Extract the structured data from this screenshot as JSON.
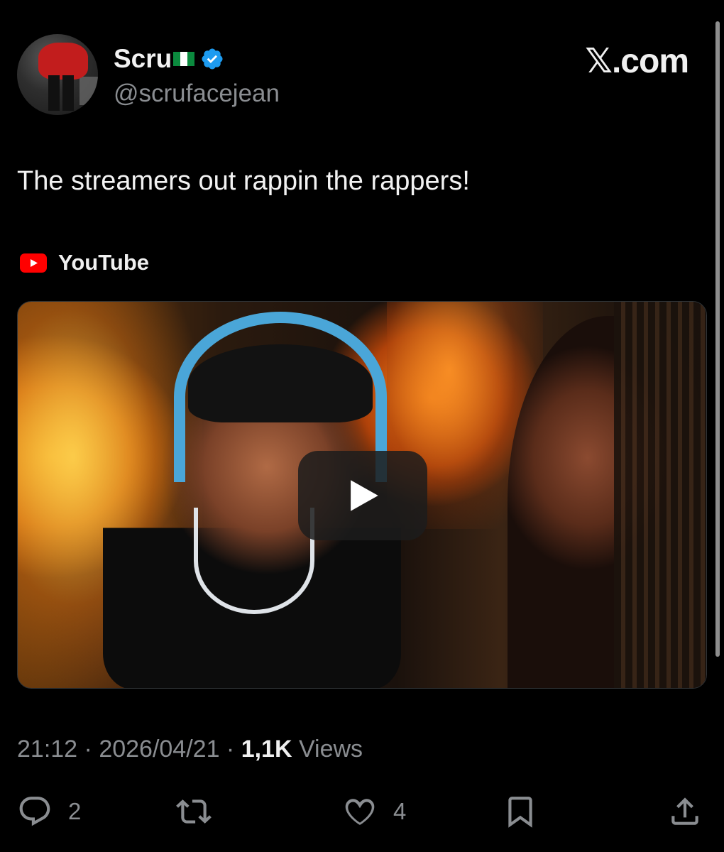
{
  "header": {
    "display_name": "Scru",
    "flag_colors": [
      "#0b8a3e",
      "#ffffff",
      "#0b8a3e"
    ],
    "handle": "@scrufacejean",
    "verified_color": "#1d9bf0",
    "brand": "𝕏.com"
  },
  "tweet": {
    "text": "The streamers out rappin the rappers!"
  },
  "source": {
    "label": "YouTube",
    "icon": "youtube-icon",
    "icon_color": "#ff0000"
  },
  "media": {
    "play_icon": "play-icon"
  },
  "meta": {
    "time": "21:12",
    "separator": " · ",
    "date": "2026/04/21",
    "views_count": "1,1K",
    "views_label": " Views"
  },
  "actions": {
    "replies": "2",
    "reposts": "",
    "likes": "4",
    "icons": [
      "reply-icon",
      "repost-icon",
      "like-icon",
      "bookmark-icon",
      "share-icon"
    ]
  }
}
